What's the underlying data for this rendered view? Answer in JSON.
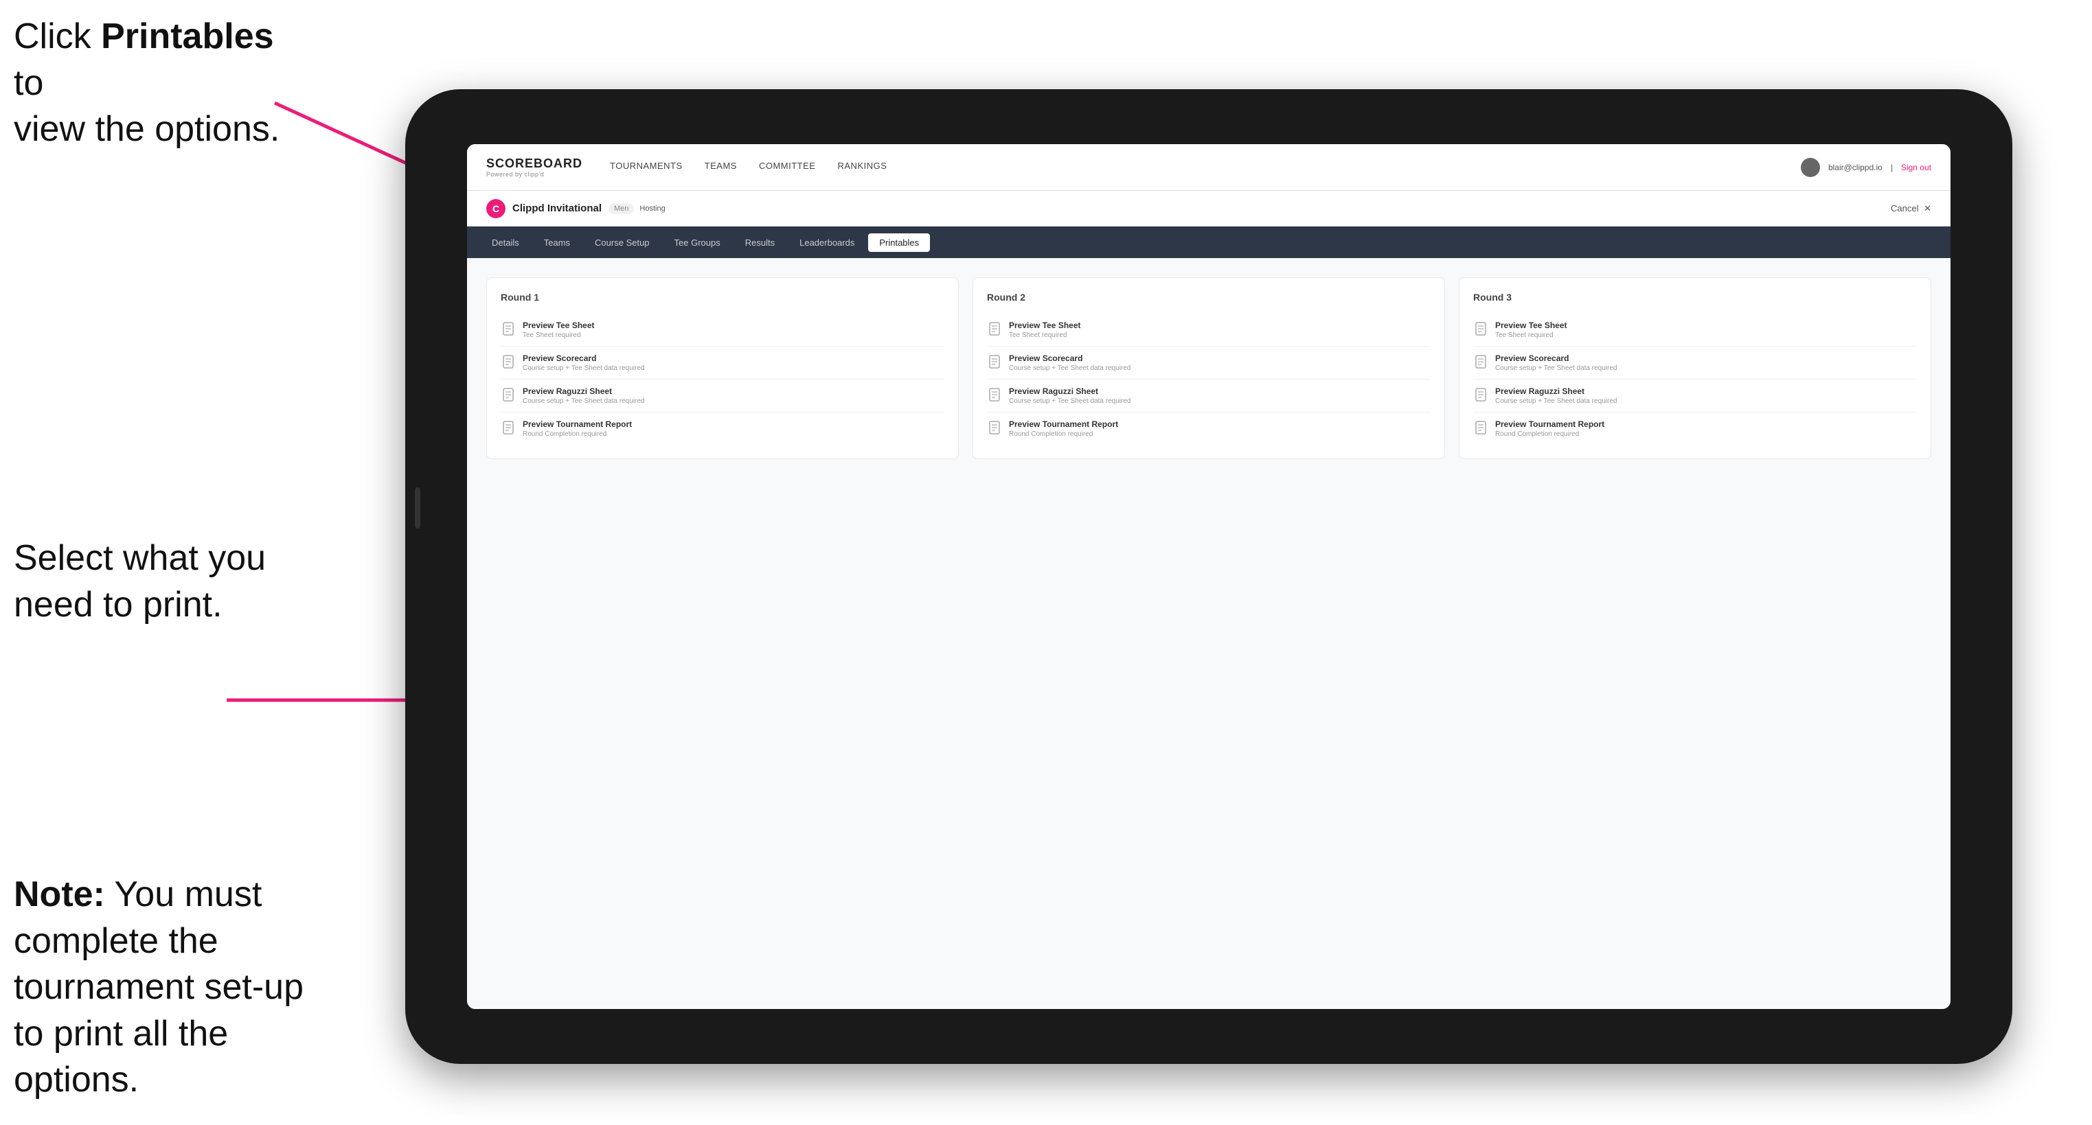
{
  "instructions": {
    "top_line1": "Click ",
    "top_bold": "Printables",
    "top_line2": " to",
    "top_line3": "view the options.",
    "middle_line1": "Select what you",
    "middle_line2": "need to print.",
    "bottom_bold": "Note:",
    "bottom_line1": " You must",
    "bottom_line2": "complete the",
    "bottom_line3": "tournament set-up",
    "bottom_line4": "to print all the options."
  },
  "top_nav": {
    "logo_title": "SCOREBOARD",
    "logo_sub": "Powered by clipp'd",
    "links": [
      {
        "label": "TOURNAMENTS",
        "active": false
      },
      {
        "label": "TEAMS",
        "active": false
      },
      {
        "label": "COMMITTEE",
        "active": false
      },
      {
        "label": "RANKINGS",
        "active": false
      }
    ],
    "user_email": "blair@clippd.io",
    "sign_out": "Sign out"
  },
  "tournament": {
    "icon": "C",
    "name": "Clippd Invitational",
    "badge": "Men",
    "hosting": "Hosting",
    "cancel": "Cancel"
  },
  "sub_tabs": [
    {
      "label": "Details",
      "active": false
    },
    {
      "label": "Teams",
      "active": false
    },
    {
      "label": "Course Setup",
      "active": false
    },
    {
      "label": "Tee Groups",
      "active": false
    },
    {
      "label": "Results",
      "active": false
    },
    {
      "label": "Leaderboards",
      "active": false
    },
    {
      "label": "Printables",
      "active": true
    }
  ],
  "rounds": [
    {
      "title": "Round 1",
      "items": [
        {
          "title": "Preview Tee Sheet",
          "subtitle": "Tee Sheet required"
        },
        {
          "title": "Preview Scorecard",
          "subtitle": "Course setup + Tee Sheet data required"
        },
        {
          "title": "Preview Raguzzi Sheet",
          "subtitle": "Course setup + Tee Sheet data required"
        },
        {
          "title": "Preview Tournament Report",
          "subtitle": "Round Completion required"
        }
      ]
    },
    {
      "title": "Round 2",
      "items": [
        {
          "title": "Preview Tee Sheet",
          "subtitle": "Tee Sheet required"
        },
        {
          "title": "Preview Scorecard",
          "subtitle": "Course setup + Tee Sheet data required"
        },
        {
          "title": "Preview Raguzzi Sheet",
          "subtitle": "Course setup + Tee Sheet data required"
        },
        {
          "title": "Preview Tournament Report",
          "subtitle": "Round Completion required"
        }
      ]
    },
    {
      "title": "Round 3",
      "items": [
        {
          "title": "Preview Tee Sheet",
          "subtitle": "Tee Sheet required"
        },
        {
          "title": "Preview Scorecard",
          "subtitle": "Course setup + Tee Sheet data required"
        },
        {
          "title": "Preview Raguzzi Sheet",
          "subtitle": "Course setup + Tee Sheet data required"
        },
        {
          "title": "Preview Tournament Report",
          "subtitle": "Round Completion required"
        }
      ]
    }
  ]
}
